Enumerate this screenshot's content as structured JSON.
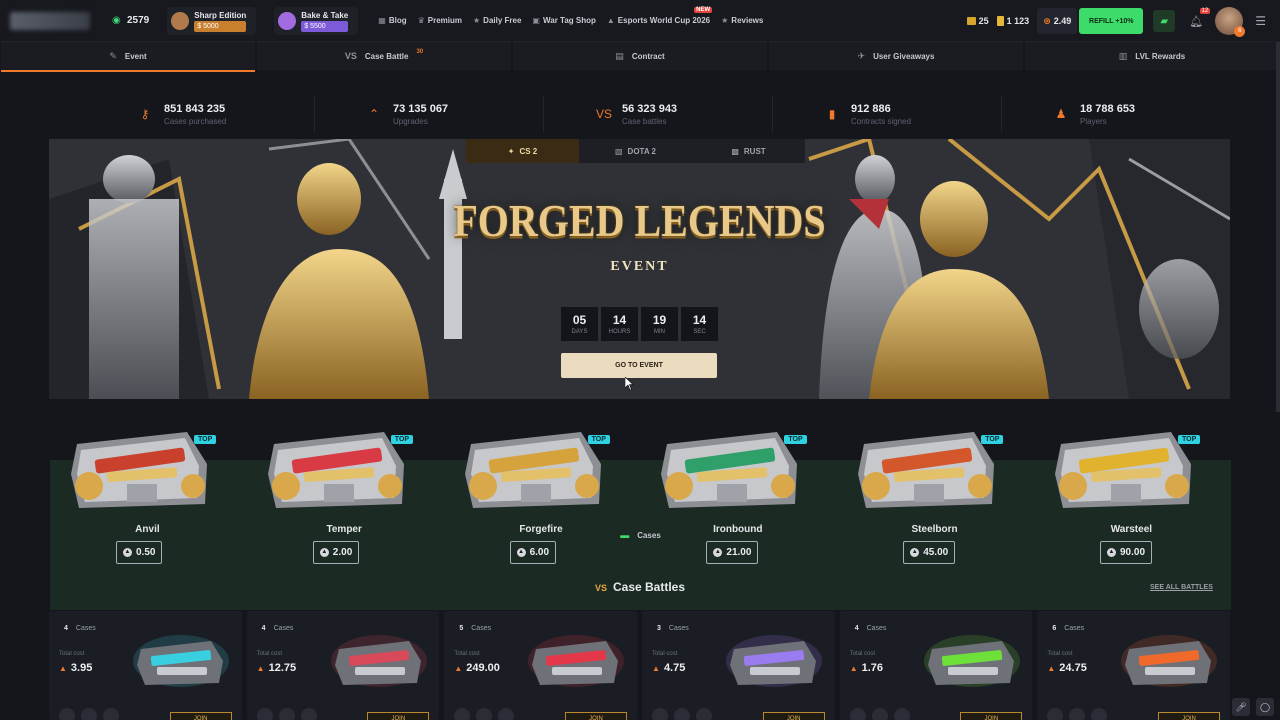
{
  "header": {
    "online_count": "2579",
    "promos": [
      {
        "name": "Sharp Edition",
        "price": "$ 5000",
        "color": "#c8802f",
        "avatar": "#b07a4a"
      },
      {
        "name": "Bake & Take",
        "price": "$ 5500",
        "color": "#7c5ad8",
        "avatar": "#a36be0"
      }
    ],
    "nav": [
      {
        "label": "Blog",
        "icon": "blog-icon",
        "glyph": "▦"
      },
      {
        "label": "Premium",
        "icon": "premium-icon",
        "glyph": "♛"
      },
      {
        "label": "Daily Free",
        "icon": "star-icon",
        "glyph": "★"
      },
      {
        "label": "War Tag Shop",
        "icon": "shop-icon",
        "glyph": "▣"
      },
      {
        "label": "Esports World Cup 2026",
        "icon": "trophy-icon",
        "glyph": "▲",
        "badge": "NEW"
      },
      {
        "label": "Reviews",
        "icon": "star-icon",
        "glyph": "★"
      }
    ],
    "coins": "25",
    "tickets": "1 123",
    "balance": "2.49",
    "refill_label": "REFILL +10%",
    "notifications": "12",
    "avatar_level": "6"
  },
  "tabs": [
    {
      "label": "Cases",
      "icon": "cases-icon",
      "glyph": "▬"
    },
    {
      "label": "Event",
      "icon": "event-icon",
      "glyph": "✎"
    },
    {
      "label": "Case Battle",
      "icon": "versus-icon",
      "glyph": "VS",
      "sup": "30"
    },
    {
      "label": "Contract",
      "icon": "contract-icon",
      "glyph": "▤"
    },
    {
      "label": "User Giveaways",
      "icon": "giveaway-icon",
      "glyph": "✈"
    },
    {
      "label": "LVL Rewards",
      "icon": "chart-icon",
      "glyph": "▥"
    }
  ],
  "stats": [
    {
      "value": "851 843 235",
      "label": "Cases purchased",
      "icon": "key-icon",
      "glyph": "⚷"
    },
    {
      "value": "73 135 067",
      "label": "Upgrades",
      "icon": "upgrade-icon",
      "glyph": "⌃"
    },
    {
      "value": "56 323 943",
      "label": "Case battles",
      "icon": "versus-icon",
      "glyph": "VS"
    },
    {
      "value": "912 886",
      "label": "Contracts signed",
      "icon": "document-icon",
      "glyph": "▮"
    },
    {
      "value": "18 788 653",
      "label": "Players",
      "icon": "players-icon",
      "glyph": "♟"
    }
  ],
  "banner": {
    "games": [
      {
        "label": "CS 2",
        "glyph": "✦"
      },
      {
        "label": "DOTA 2",
        "glyph": "▧"
      },
      {
        "label": "RUST",
        "glyph": "▩"
      }
    ],
    "title": "FORGED LEGENDS",
    "subtitle": "EVENT",
    "countdown": [
      {
        "value": "05",
        "unit": "DAYS"
      },
      {
        "value": "14",
        "unit": "HOURS"
      },
      {
        "value": "19",
        "unit": "MIN"
      },
      {
        "value": "14",
        "unit": "SEC"
      }
    ],
    "cta": "GO TO EVENT"
  },
  "cases": [
    {
      "name": "Anvil",
      "price": "0.50",
      "badge": "TOP",
      "accent": "#c9402c"
    },
    {
      "name": "Temper",
      "price": "2.00",
      "badge": "TOP",
      "accent": "#d83b44"
    },
    {
      "name": "Forgefire",
      "price": "6.00",
      "badge": "TOP",
      "accent": "#d6a23c"
    },
    {
      "name": "Ironbound",
      "price": "21.00",
      "badge": "TOP",
      "accent": "#2fa06a"
    },
    {
      "name": "Steelborn",
      "price": "45.00",
      "badge": "TOP",
      "accent": "#d4572c"
    },
    {
      "name": "Warsteel",
      "price": "90.00",
      "badge": "TOP",
      "accent": "#e0b22e"
    }
  ],
  "battles_section": {
    "title": "Case Battles",
    "see_all": "SEE ALL BATTLES",
    "cases_label": "Cases",
    "total_label": "Total cost",
    "join_label": "JOIN",
    "items": [
      {
        "count": "4",
        "total": "3.95",
        "accent": "#38d0e0"
      },
      {
        "count": "4",
        "total": "12.75",
        "accent": "#d84a5a"
      },
      {
        "count": "5",
        "total": "249.00",
        "accent": "#e2384a"
      },
      {
        "count": "3",
        "total": "4.75",
        "accent": "#9a7cf0"
      },
      {
        "count": "4",
        "total": "1.76",
        "accent": "#6ee03a"
      },
      {
        "count": "6",
        "total": "24.75",
        "accent": "#ef6a2a"
      }
    ]
  }
}
